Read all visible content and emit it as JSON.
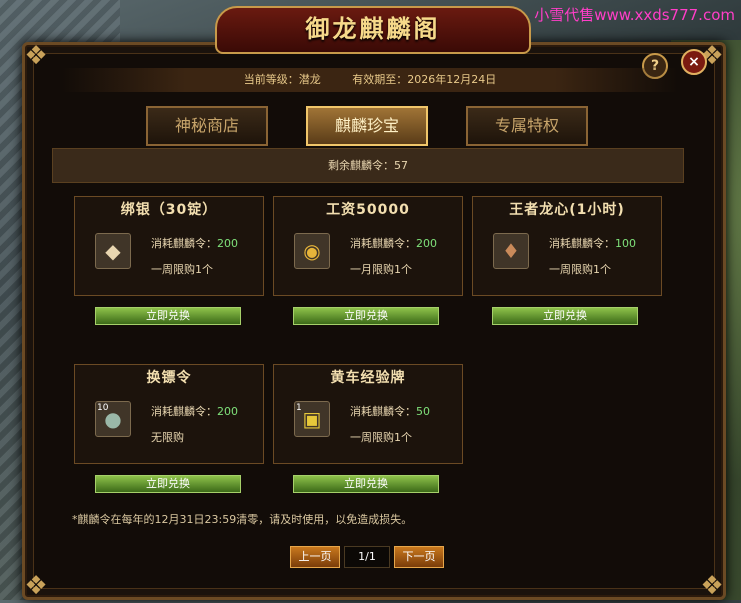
{
  "watermark": "小雪代售www.xxds777.com",
  "title": "御龙麒麟阁",
  "info": {
    "level_label": "当前等级：潜龙",
    "expiry_label": "有效期至：2026年12月24日"
  },
  "buttons": {
    "help": "?",
    "close": "×"
  },
  "tabs": [
    {
      "label": "神秘商店",
      "active": false
    },
    {
      "label": "麒麟珍宝",
      "active": true
    },
    {
      "label": "专属特权",
      "active": false
    }
  ],
  "remaining": "剩余麒麟令：57",
  "cost_prefix": "消耗麒麟令：",
  "items": [
    {
      "name": "绑银（30锭）",
      "icon": "silver-ingot-icon",
      "glyph": "◆",
      "count": "",
      "cost": "200",
      "limit": "一周限购1个",
      "redeem": "立即兑换"
    },
    {
      "name": "工资50000",
      "icon": "gold-coin-stack-icon",
      "glyph": "◉",
      "count": "",
      "cost": "200",
      "limit": "一月限购1个",
      "redeem": "立即兑换"
    },
    {
      "name": "王者龙心(1小时)",
      "icon": "dragon-heart-icon",
      "glyph": "♦",
      "count": "",
      "cost": "100",
      "limit": "一周限购1个",
      "redeem": "立即兑换"
    },
    {
      "name": "换镖令",
      "icon": "escort-token-icon",
      "glyph": "●",
      "count": "10",
      "cost": "200",
      "limit": "无限购",
      "redeem": "立即兑换"
    },
    {
      "name": "黄车经验牌",
      "icon": "yellow-cart-exp-icon",
      "glyph": "▣",
      "count": "1",
      "cost": "50",
      "limit": "一周限购1个",
      "redeem": "立即兑换"
    }
  ],
  "footer_note": "*麒麟令在每年的12月31日23:59清零，请及时使用，以免造成损失。",
  "pager": {
    "prev": "上一页",
    "page": "1/1",
    "next": "下一页"
  }
}
